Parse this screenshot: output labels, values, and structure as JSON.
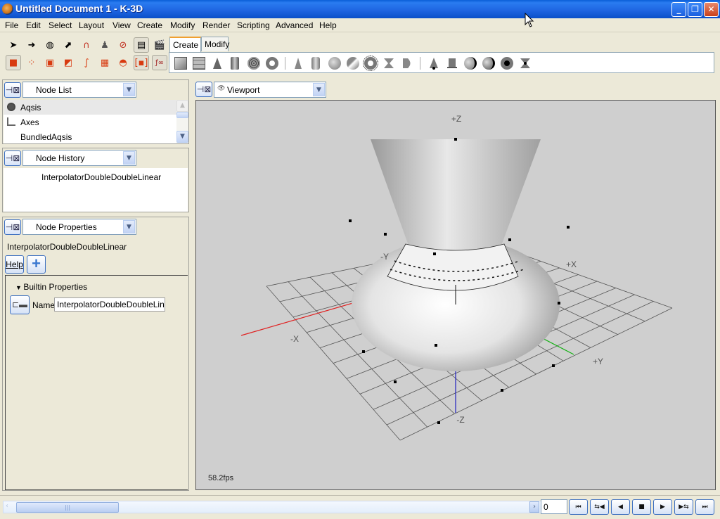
{
  "window": {
    "title": "Untitled Document 1  - K-3D",
    "controls": {
      "minimize": "_",
      "restore": "❐",
      "close": "✕"
    }
  },
  "menubar": {
    "items": [
      "File",
      "Edit",
      "Select",
      "Layout",
      "View",
      "Create",
      "Modify",
      "Render",
      "Scripting",
      "Advanced",
      "Help"
    ]
  },
  "toolbar": {
    "row1_icons": [
      "select-arrow-icon",
      "move-icon",
      "rotate-icon",
      "scale-icon",
      "snap-magnet-icon",
      "parent-icon",
      "unparent-icon",
      "render-preview-icon",
      "render-animation-icon"
    ],
    "row2_icons": [
      "select-node-icon",
      "select-point-icon",
      "select-edge-icon",
      "select-face-icon",
      "select-curve-icon",
      "select-patch-icon",
      "select-uniform-icon",
      "frame-selection-icon",
      "script-function-icon"
    ],
    "tabs": [
      {
        "label": "Create",
        "active": true
      },
      {
        "label": "Modify",
        "active": false
      }
    ],
    "create_group1": [
      "poly-cube-icon",
      "poly-grid-icon",
      "poly-cone-icon",
      "poly-cylinder-icon",
      "poly-disk-icon",
      "poly-torus-icon"
    ],
    "create_group2": [
      "quadric-cone-icon",
      "quadric-cylinder-icon",
      "quadric-sphere-icon",
      "quadric-paraboloid-icon",
      "quadric-torus-icon",
      "quadric-hyperboloid-icon",
      "quadric-disk-icon"
    ],
    "create_group3": [
      "nurbs-cone-icon",
      "nurbs-cylinder-icon",
      "nurbs-sphere-icon",
      "nurbs-paraboloid-icon",
      "nurbs-torus-icon",
      "nurbs-hyperboloid-icon"
    ]
  },
  "node_list": {
    "panel": "Node List",
    "items": [
      {
        "label": "Aqsis",
        "icon": "aqsis-icon",
        "selected": true
      },
      {
        "label": "Axes",
        "icon": "axes-icon",
        "selected": false
      },
      {
        "label": "BundledAqsis",
        "icon": "",
        "selected": false
      }
    ]
  },
  "node_history": {
    "panel": "Node History",
    "items": [
      "InterpolatorDoubleDoubleLinear"
    ]
  },
  "node_properties": {
    "panel": "Node Properties",
    "node_name": "InterpolatorDoubleDoubleLinear",
    "help_label": "Help",
    "add_label": "+",
    "section": "Builtin Properties",
    "name_label": "Name",
    "name_value": "InterpolatorDoubleDoubleLinear"
  },
  "viewport": {
    "panel": "Viewport",
    "axis_labels": {
      "pz": "+Z",
      "nz": "-Z",
      "px": "+X",
      "nx": "-X",
      "py": "+Y",
      "ny": "-Y"
    },
    "fps": "58.2fps",
    "colors": {
      "x_axis": "#e02020",
      "y_axis": "#10b010",
      "z_axis": "#2020c0",
      "background": "#cfcfcf"
    }
  },
  "timeline": {
    "frame": "0",
    "buttons": [
      {
        "name": "first-frame-button",
        "glyph": "⏮"
      },
      {
        "name": "play-reverse-loop-button",
        "glyph": "⇆◀"
      },
      {
        "name": "play-reverse-button",
        "glyph": "◀"
      },
      {
        "name": "stop-button",
        "glyph": "■"
      },
      {
        "name": "play-button",
        "glyph": "▶"
      },
      {
        "name": "play-loop-button",
        "glyph": "▶⇆"
      },
      {
        "name": "last-frame-button",
        "glyph": "⏭"
      }
    ]
  }
}
